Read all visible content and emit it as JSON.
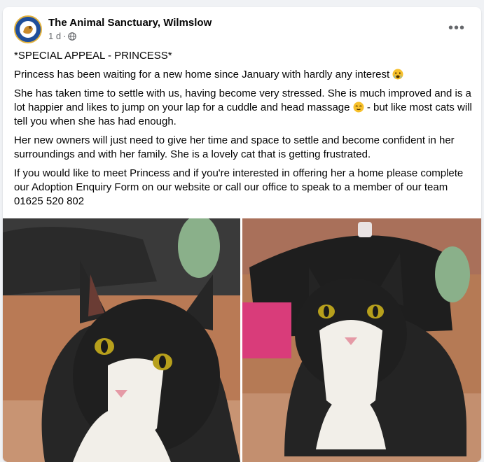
{
  "post": {
    "page_name": "The Animal Sanctuary, Wilmslow",
    "timestamp": "1 d",
    "separator": "·",
    "privacy_icon": "globe-icon",
    "more_icon": "more-options-icon",
    "more_label": "•••",
    "paragraphs": {
      "p1": "*SPECIAL APPEAL - PRINCESS*",
      "p2": "Princess has been waiting for a new home since January with hardly any interest",
      "p3a": "She has taken time to settle with us, having become very stressed. She is much improved and is a lot happier and likes to jump on your lap for a cuddle  and head massage",
      "p3b": "- but like most cats will tell you when she has had enough.",
      "p4": "Her new owners will just need to give her time and space to settle and become confident in her surroundings and with her family. She is a lovely cat that is getting frustrated.",
      "p5": "If you would like to meet Princess and if you're interested in offering her a home please complete our Adoption Enquiry Form on our website or call our office to speak to a member of our team 01625 520 802"
    },
    "emojis": [
      "crying-face-emoji",
      "content-face-emoji"
    ],
    "photos": [
      "cat-photo-1",
      "cat-photo-2"
    ]
  },
  "colors": {
    "background": "#f0f2f5",
    "card": "#ffffff",
    "text": "#050505",
    "secondary_text": "#65676b"
  }
}
